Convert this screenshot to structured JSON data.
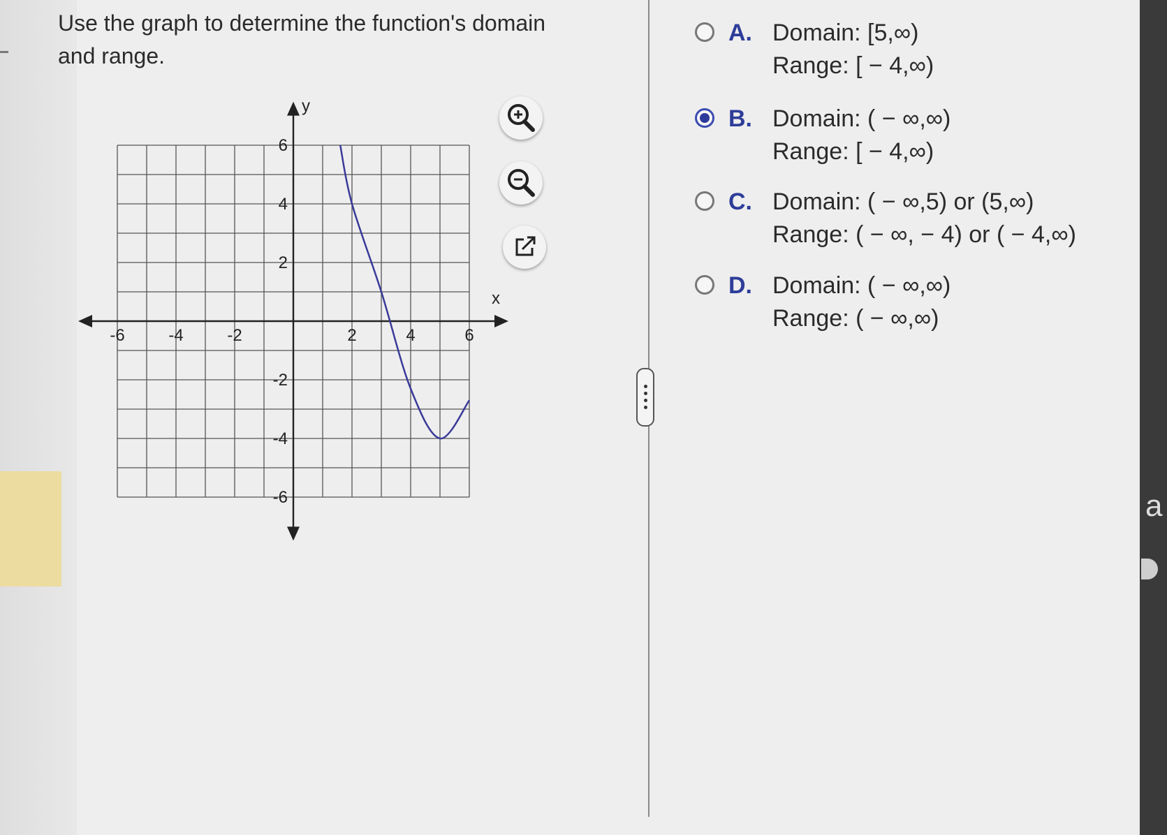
{
  "question": {
    "line1": "Use the graph to determine the function's domain",
    "line2": "and range."
  },
  "graph": {
    "x_axis_label": "x",
    "y_axis_label": "y",
    "x_ticks": [
      "-6",
      "-4",
      "-2",
      "2",
      "4",
      "6"
    ],
    "y_ticks": [
      "6",
      "4",
      "2",
      "-2",
      "-4",
      "-6"
    ],
    "curve_color": "#3a3a9a",
    "curve_vertex": [
      5,
      -4
    ],
    "curve_points": [
      [
        1.6,
        6.0
      ],
      [
        2.0,
        4.0
      ],
      [
        3.0,
        1.0
      ],
      [
        4.0,
        -2.3
      ],
      [
        5.0,
        -4.0
      ],
      [
        6.0,
        -2.7
      ]
    ]
  },
  "tools": {
    "zoom_in_icon": "zoom-in-icon",
    "zoom_out_icon": "zoom-out-icon",
    "popout_icon": "external-link-icon"
  },
  "options": [
    {
      "letter": "A.",
      "domain": "Domain: [5,∞)",
      "range": "Range: [ − 4,∞)",
      "selected": false
    },
    {
      "letter": "B.",
      "domain": "Domain: ( − ∞,∞)",
      "range": "Range: [ − 4,∞)",
      "selected": true
    },
    {
      "letter": "C.",
      "domain": "Domain: ( − ∞,5) or (5,∞)",
      "range": "Range: ( − ∞, − 4) or ( − 4,∞)",
      "selected": false
    },
    {
      "letter": "D.",
      "domain": "Domain: ( − ∞,∞)",
      "range": "Range: ( − ∞,∞)",
      "selected": false
    }
  ],
  "accent_color": "#2e3d99",
  "edge_letter": "a"
}
